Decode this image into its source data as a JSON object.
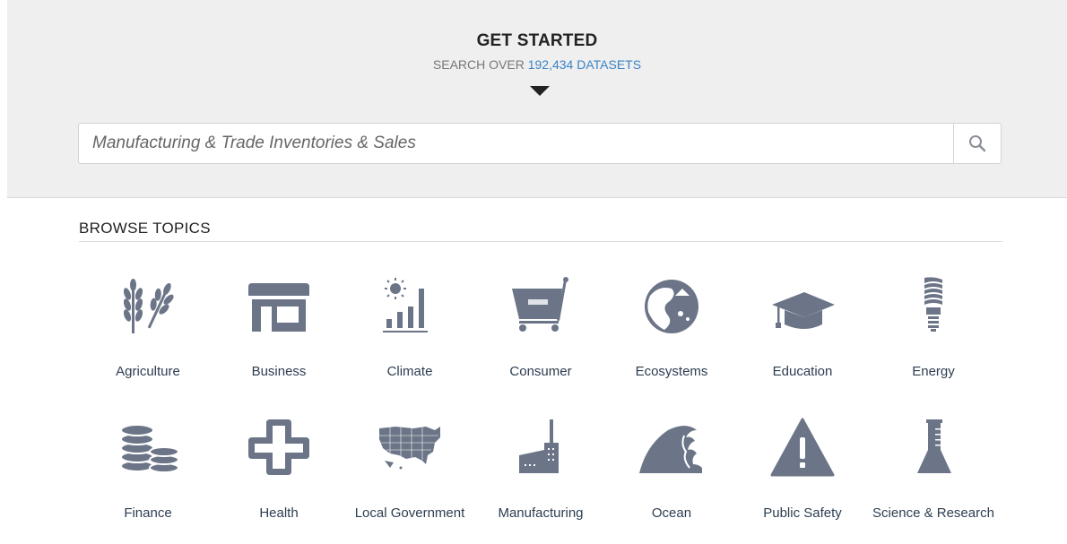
{
  "hero": {
    "title": "GET STARTED",
    "subtitle_prefix": "SEARCH OVER ",
    "dataset_count": "192,434 DATASETS"
  },
  "search": {
    "placeholder": "Manufacturing & Trade Inventories & Sales"
  },
  "browse": {
    "heading": "BROWSE TOPICS",
    "topics": [
      {
        "label": "Agriculture",
        "icon": "wheat-icon"
      },
      {
        "label": "Business",
        "icon": "storefront-icon"
      },
      {
        "label": "Climate",
        "icon": "sun-bar-chart-icon"
      },
      {
        "label": "Consumer",
        "icon": "shopping-cart-icon"
      },
      {
        "label": "Ecosystems",
        "icon": "ecosystem-icon"
      },
      {
        "label": "Education",
        "icon": "graduation-cap-icon"
      },
      {
        "label": "Energy",
        "icon": "light-bulb-icon"
      },
      {
        "label": "Finance",
        "icon": "coin-stacks-icon"
      },
      {
        "label": "Health",
        "icon": "medical-cross-icon"
      },
      {
        "label": "Local Government",
        "icon": "us-map-icon"
      },
      {
        "label": "Manufacturing",
        "icon": "factory-icon"
      },
      {
        "label": "Ocean",
        "icon": "wave-icon"
      },
      {
        "label": "Public Safety",
        "icon": "warning-triangle-icon"
      },
      {
        "label": "Science & Research",
        "icon": "flask-icon"
      }
    ]
  },
  "colors": {
    "icon": "#6b7587",
    "accent": "#3b83c6",
    "hero_bg": "#efefef"
  }
}
